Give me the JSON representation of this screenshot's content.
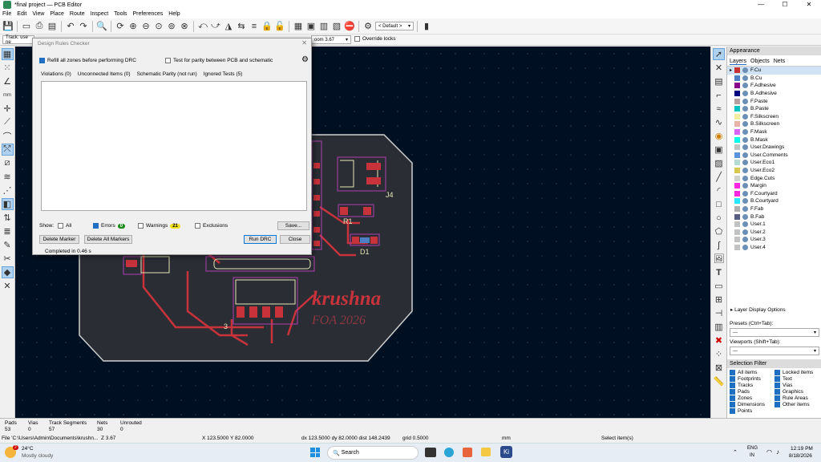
{
  "window": {
    "title": "*final project — PCB Editor",
    "min": "—",
    "max": "☐",
    "close": "✕"
  },
  "menu": [
    "File",
    "Edit",
    "View",
    "Place",
    "Route",
    "Inspect",
    "Tools",
    "Preferences",
    "Help"
  ],
  "toolbar": {
    "preset_combo": "< Default >"
  },
  "toolbar2": {
    "track": "Track: use ne",
    "zoom": "oom 3.67",
    "override": "Override locks"
  },
  "drc": {
    "title": "Design Rules Checker",
    "refill": "Refill all zones before performing DRC",
    "parity": "Test for parity between PCB and schematic",
    "tabs": [
      "Violations (0)",
      "Unconnected Items (0)",
      "Schematic Parity (not run)",
      "Ignored Tests (5)"
    ],
    "show": "Show:",
    "all": "All",
    "errors": "Errors",
    "errors_count": "0",
    "warnings": "Warnings",
    "warnings_count": "21",
    "exclusions": "Exclusions",
    "save": "Save...",
    "delete_marker": "Delete Marker",
    "delete_all": "Delete All Markers",
    "run": "Run DRC",
    "close": "Close",
    "completed": "Completed in 0.46 s"
  },
  "board": {
    "j4": "J4",
    "r1": "R1",
    "d1": "D1",
    "krushna": "krushna",
    "foa": "FOA 2026",
    "three": "3"
  },
  "appearance": {
    "title": "Appearance",
    "tabs": [
      "Layers",
      "Objects",
      "Nets"
    ],
    "layers": [
      {
        "name": "F.Cu",
        "color": "#c83232"
      },
      {
        "name": "B.Cu",
        "color": "#4d7fc4"
      },
      {
        "name": "F.Adhesive",
        "color": "#8b008b"
      },
      {
        "name": "B.Adhesive",
        "color": "#000080"
      },
      {
        "name": "F.Paste",
        "color": "#b4a0a0"
      },
      {
        "name": "B.Paste",
        "color": "#00c2c2"
      },
      {
        "name": "F.Silkscreen",
        "color": "#f2eda1"
      },
      {
        "name": "B.Silkscreen",
        "color": "#e8b2a7"
      },
      {
        "name": "F.Mask",
        "color": "#d864ff"
      },
      {
        "name": "B.Mask",
        "color": "#02ffee"
      },
      {
        "name": "User.Drawings",
        "color": "#c2c2c2"
      },
      {
        "name": "User.Comments",
        "color": "#5994dc"
      },
      {
        "name": "User.Eco1",
        "color": "#b4dbd2"
      },
      {
        "name": "User.Eco2",
        "color": "#d8c852"
      },
      {
        "name": "Edge.Cuts",
        "color": "#d0d2cd"
      },
      {
        "name": "Margin",
        "color": "#ff26e2"
      },
      {
        "name": "F.Courtyard",
        "color": "#ff26e2"
      },
      {
        "name": "B.Courtyard",
        "color": "#26e9ff"
      },
      {
        "name": "F.Fab",
        "color": "#afafaf"
      },
      {
        "name": "B.Fab",
        "color": "#585d84"
      },
      {
        "name": "User.1",
        "color": "#c2c2c2"
      },
      {
        "name": "User.2",
        "color": "#c2c2c2"
      },
      {
        "name": "User.3",
        "color": "#c2c2c2"
      },
      {
        "name": "User.4",
        "color": "#c2c2c2"
      }
    ],
    "layer_display": "Layer Display Options",
    "presets_label": "Presets (Ctrl+Tab):",
    "presets_value": "---",
    "viewports_label": "Viewports (Shift+Tab):",
    "viewports_value": "---"
  },
  "selection_filter": {
    "title": "Selection Filter",
    "items": [
      "All items",
      "Locked items",
      "Footprints",
      "Text",
      "Tracks",
      "Vias",
      "Pads",
      "Graphics",
      "Zones",
      "Rule Areas",
      "Dimensions",
      "Other items",
      "Points"
    ]
  },
  "status": {
    "pads_label": "Pads",
    "pads": "53",
    "vias_label": "Vias",
    "vias": "0",
    "tracks_label": "Track Segments",
    "tracks": "57",
    "nets_label": "Nets",
    "nets": "30",
    "unrouted_label": "Unrouted",
    "unrouted": "0",
    "file": "File 'C:\\Users\\Admin\\Documents\\krushn...",
    "z": "Z 3.67",
    "xy": "X 123.5000  Y 82.0000",
    "dxy": "dx 123.5000  dy 82.0000  dist 148.2439",
    "grid": "grid 0.5000",
    "units": "mm",
    "select": "Select item(s)"
  },
  "taskbar": {
    "temp": "24°C",
    "weather": "Mostly cloudy",
    "badge": "2",
    "search": "Search",
    "lang1": "ENG",
    "lang2": "IN",
    "time": "12:19 PM",
    "date": "8/18/2026"
  }
}
